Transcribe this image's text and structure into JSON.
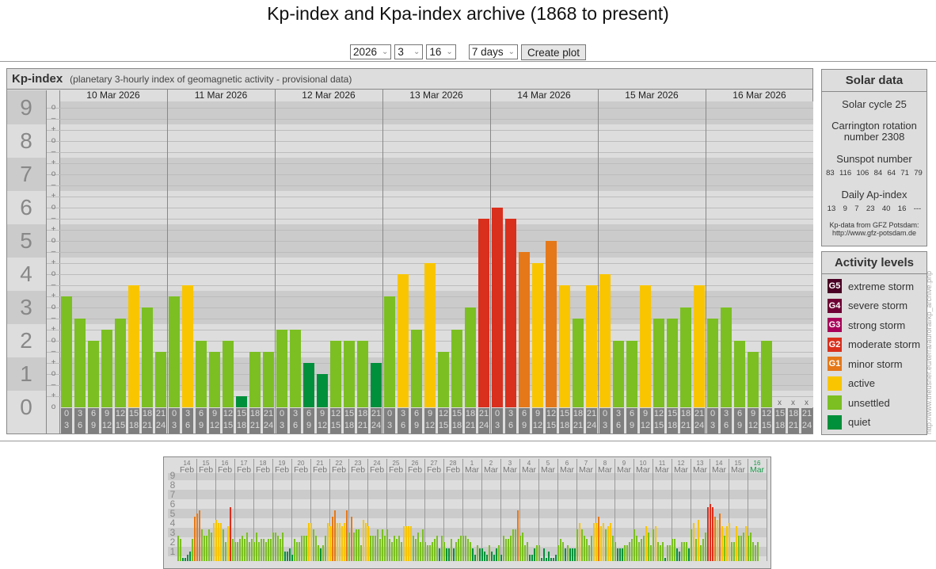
{
  "page_title": "Kp-index and Kpa-index archive (1868 to present)",
  "controls": {
    "year": "2026",
    "month": "3",
    "day": "16",
    "range": "7 days",
    "create_label": "Create plot"
  },
  "panel": {
    "title": "Kp-index",
    "subtitle": "(planetary 3-hourly index of geomagnetic activity - provisional data)"
  },
  "colors": {
    "quiet": "#008f3a",
    "unsettled": "#7bbf22",
    "active": "#f8c500",
    "G1": "#e57818",
    "G2": "#d92f1d",
    "G3": "#a8005a",
    "G4": "#6e0035",
    "G5": "#4a0025"
  },
  "chart_data": [
    {
      "type": "bar",
      "title": "Kp-index",
      "ylabel": "Kp",
      "ylim": [
        0,
        9
      ],
      "y_ticks": [
        "0",
        "1",
        "2",
        "3",
        "4",
        "5",
        "6",
        "7",
        "8",
        "9"
      ],
      "hour_ranges": [
        [
          "0",
          "3"
        ],
        [
          "3",
          "6"
        ],
        [
          "6",
          "9"
        ],
        [
          "9",
          "12"
        ],
        [
          "12",
          "15"
        ],
        [
          "15",
          "18"
        ],
        [
          "18",
          "21"
        ],
        [
          "21",
          "24"
        ]
      ],
      "missing_marker": "x",
      "days": [
        {
          "label": "10 Mar 2026",
          "values": [
            3.33,
            2.67,
            2.0,
            2.33,
            2.67,
            3.67,
            3.0,
            1.67
          ]
        },
        {
          "label": "11 Mar 2026",
          "values": [
            3.33,
            3.67,
            2.0,
            1.67,
            2.0,
            0.33,
            1.67,
            1.67
          ]
        },
        {
          "label": "12 Mar 2026",
          "values": [
            2.33,
            2.33,
            1.33,
            1.0,
            2.0,
            2.0,
            2.0,
            1.33
          ]
        },
        {
          "label": "13 Mar 2026",
          "values": [
            3.33,
            4.0,
            2.33,
            4.33,
            1.67,
            2.33,
            3.0,
            5.67
          ]
        },
        {
          "label": "14 Mar 2026",
          "values": [
            6.0,
            5.67,
            4.67,
            4.33,
            5.0,
            3.67,
            2.67,
            3.67
          ]
        },
        {
          "label": "15 Mar 2026",
          "values": [
            4.0,
            2.0,
            2.0,
            3.67,
            2.67,
            2.67,
            3.0,
            3.67
          ]
        },
        {
          "label": "16 Mar 2026",
          "values": [
            2.67,
            3.0,
            2.0,
            1.67,
            2.0,
            null,
            null,
            null
          ]
        }
      ]
    },
    {
      "type": "bar",
      "title": "Kp overview",
      "ylim": [
        0,
        9
      ],
      "y_ticks": [
        "1",
        "2",
        "3",
        "4",
        "5",
        "6",
        "7",
        "8",
        "9"
      ],
      "days": [
        {
          "day": "14",
          "month": "Feb",
          "values": [
            2.7,
            2.3,
            0.3,
            0.3,
            0.7,
            1,
            2.3,
            4.7
          ]
        },
        {
          "day": "15",
          "month": "Feb",
          "values": [
            5,
            5.3,
            3.3,
            2.7,
            2.7,
            3.3,
            3,
            4
          ]
        },
        {
          "day": "16",
          "month": "Feb",
          "values": [
            4.3,
            4,
            4,
            3.3,
            2,
            3.7,
            5.7,
            2.3
          ]
        },
        {
          "day": "17",
          "month": "Feb",
          "values": [
            2,
            2,
            2.3,
            2.7,
            2.3,
            3,
            2,
            2.3
          ]
        },
        {
          "day": "18",
          "month": "Feb",
          "values": [
            2,
            3,
            2,
            2.3,
            2.3,
            2,
            2.3,
            2.3
          ]
        },
        {
          "day": "19",
          "month": "Feb",
          "values": [
            3,
            3,
            2.7,
            2.3,
            3,
            1,
            1,
            1.3
          ]
        },
        {
          "day": "20",
          "month": "Feb",
          "values": [
            0.7,
            2.3,
            2,
            2,
            2.7,
            2.7,
            2.7,
            4
          ]
        },
        {
          "day": "21",
          "month": "Feb",
          "values": [
            4,
            3.3,
            2.7,
            1.7,
            1.3,
            1.7,
            2.7,
            4
          ]
        },
        {
          "day": "22",
          "month": "Feb",
          "values": [
            3.7,
            4.7,
            5.3,
            4,
            4,
            3.7,
            4,
            5.3
          ]
        },
        {
          "day": "23",
          "month": "Feb",
          "values": [
            3,
            4.7,
            3,
            3.3,
            3.3,
            1.7,
            4.3,
            4
          ]
        },
        {
          "day": "24",
          "month": "Feb",
          "values": [
            3.7,
            2.7,
            2.7,
            2.7,
            3.3,
            2.3,
            3.3,
            2.7
          ]
        },
        {
          "day": "25",
          "month": "Feb",
          "values": [
            3.3,
            2.3,
            2,
            2.7,
            2.3,
            2.7,
            2,
            3.7
          ]
        },
        {
          "day": "26",
          "month": "Feb",
          "values": [
            3.7,
            3.7,
            3.7,
            2.7,
            2.3,
            3,
            2,
            3.3
          ]
        },
        {
          "day": "27",
          "month": "Feb",
          "values": [
            2,
            1.7,
            1.7,
            2,
            2.3,
            2.7,
            1.3,
            2.7
          ]
        },
        {
          "day": "28",
          "month": "Feb",
          "values": [
            2,
            1.3,
            1.3,
            2.3,
            1.3,
            2,
            2.3,
            2.7
          ]
        },
        {
          "day": "1",
          "month": "Mar",
          "values": [
            2.7,
            2.7,
            2.3,
            2,
            1.3,
            0.7,
            1.7,
            1.3
          ]
        },
        {
          "day": "2",
          "month": "Mar",
          "values": [
            1.3,
            1,
            0.7,
            1.7,
            1,
            0.7,
            1.3,
            1.7
          ]
        },
        {
          "day": "3",
          "month": "Mar",
          "values": [
            0.7,
            2.7,
            2.3,
            2.3,
            2.7,
            3.3,
            3.3,
            5.3
          ]
        },
        {
          "day": "4",
          "month": "Mar",
          "values": [
            2.7,
            3,
            1.7,
            2,
            0.7,
            0.7,
            1.3,
            1.7
          ]
        },
        {
          "day": "5",
          "month": "Mar",
          "values": [
            1.7,
            0.3,
            1.3,
            0.3,
            1,
            0.3,
            0.3,
            0.7
          ]
        },
        {
          "day": "6",
          "month": "Mar",
          "values": [
            1.7,
            2.3,
            2,
            1.3,
            1.7,
            1.3,
            1.3,
            1.3
          ]
        },
        {
          "day": "7",
          "month": "Mar",
          "values": [
            3.3,
            4,
            3.3,
            2.7,
            2.3,
            1.7,
            2.7,
            4
          ]
        },
        {
          "day": "8",
          "month": "Mar",
          "values": [
            4,
            4.7,
            3.7,
            4,
            3.3,
            3.7,
            4,
            2.7
          ]
        },
        {
          "day": "9",
          "month": "Mar",
          "values": [
            2,
            1.3,
            1.3,
            1.3,
            1.7,
            1.7,
            2,
            2.3
          ]
        },
        {
          "day": "10",
          "month": "Mar",
          "values": [
            3.33,
            2.67,
            2,
            2.33,
            2.67,
            3.67,
            3,
            1.67
          ]
        },
        {
          "day": "11",
          "month": "Mar",
          "values": [
            3.33,
            3.67,
            2,
            1.67,
            2,
            0.33,
            1.67,
            1.67
          ]
        },
        {
          "day": "12",
          "month": "Mar",
          "values": [
            2.33,
            2.33,
            1.33,
            1,
            2,
            2,
            2,
            1.33
          ]
        },
        {
          "day": "13",
          "month": "Mar",
          "values": [
            3.33,
            4,
            2.33,
            4.33,
            1.67,
            2.33,
            3,
            5.67
          ]
        },
        {
          "day": "14",
          "month": "Mar",
          "values": [
            6,
            5.67,
            4.67,
            4.33,
            5,
            3.67,
            2.67,
            3.67
          ]
        },
        {
          "day": "15",
          "month": "Mar",
          "values": [
            4,
            2,
            2,
            3.67,
            2.67,
            2.67,
            3,
            3.67
          ]
        },
        {
          "day": "16",
          "month": "Mar",
          "values": [
            2.67,
            3,
            2,
            1.67,
            2,
            null,
            null,
            null
          ],
          "current": true
        }
      ]
    }
  ],
  "solar": {
    "title": "Solar data",
    "cycle": "Solar cycle 25",
    "carrington_1": "Carrington rotation",
    "carrington_2": "number 2308",
    "sunspot_label": "Sunspot number",
    "sunspots": [
      "83",
      "116",
      "106",
      "84",
      "64",
      "71",
      "79"
    ],
    "ap_label": "Daily Ap-index",
    "ap": [
      "13",
      "9",
      "7",
      "23",
      "40",
      "16",
      "---"
    ],
    "source_1": "Kp-data from GFZ Potsdam:",
    "source_2": "http://www.gfz-potsdam.de"
  },
  "activity": {
    "title": "Activity levels",
    "levels": [
      {
        "code": "G5",
        "label": "extreme storm",
        "color": "#4a0025"
      },
      {
        "code": "G4",
        "label": "severe storm",
        "color": "#6e0035"
      },
      {
        "code": "G3",
        "label": "strong storm",
        "color": "#a8005a"
      },
      {
        "code": "G2",
        "label": "moderate storm",
        "color": "#d92f1d"
      },
      {
        "code": "G1",
        "label": "minor storm",
        "color": "#e57818"
      },
      {
        "code": "",
        "label": "active",
        "color": "#f8c500"
      },
      {
        "code": "",
        "label": "unsettled",
        "color": "#7bbf22"
      },
      {
        "code": "",
        "label": "quiet",
        "color": "#008f3a"
      }
    ]
  },
  "side_url": "http://www.theusner.eu/terra/auroral/kp_archive.php"
}
